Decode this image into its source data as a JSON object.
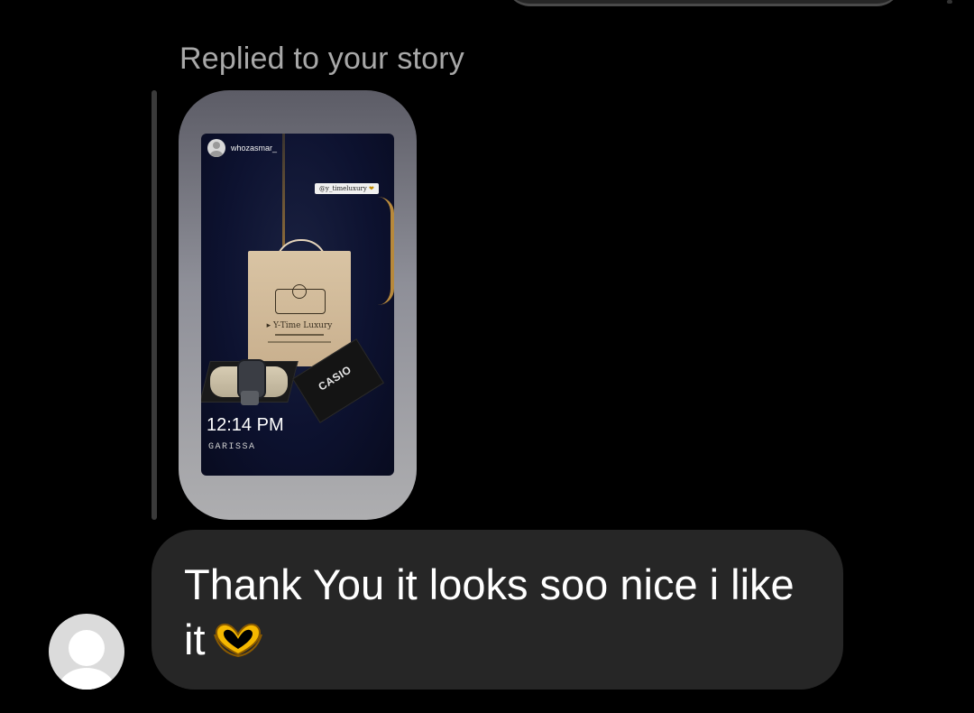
{
  "thread": {
    "reply_label": "Replied to your story",
    "story": {
      "username": "whozasmar_",
      "mention": "@y_timeluxury",
      "bag_brand": "Y-Time Luxury",
      "box_brand": "CASIO",
      "time": "12:14 PM",
      "location": "GARISSA"
    },
    "message": {
      "text": "Thank You it looks soo nice i like it",
      "emoji": "heart-hands-icon"
    }
  },
  "colors": {
    "background": "#000000",
    "bubble": "#262626",
    "label": "#a8a8a8",
    "text": "#ffffff",
    "emoji": "#f5b800"
  }
}
